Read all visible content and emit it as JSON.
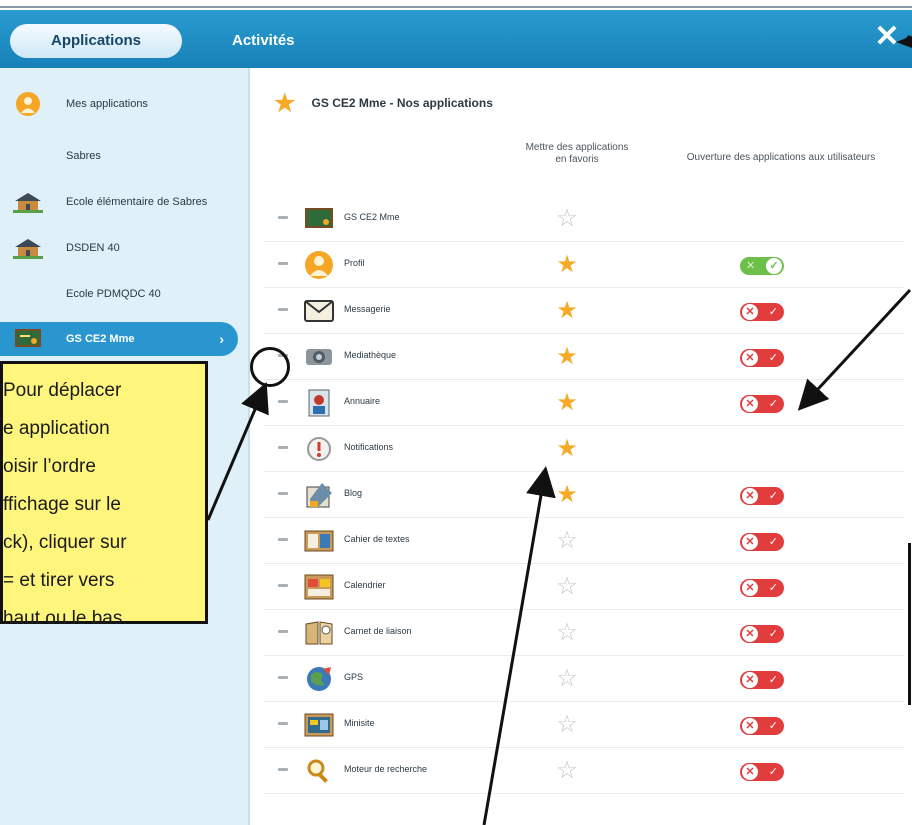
{
  "header": {
    "tab_applications": "Applications",
    "tab_activites": "Activités",
    "close_icon": "close-icon"
  },
  "sidebar": {
    "items": [
      {
        "label": "Mes applications",
        "icon": "user-apps-icon"
      },
      {
        "label": "Sabres",
        "icon": ""
      },
      {
        "label": "Ecole élémentaire de Sabres",
        "icon": "school-icon"
      },
      {
        "label": "DSDEN 40",
        "icon": "school-icon"
      },
      {
        "label": "Ecole PDMQDC 40",
        "icon": ""
      },
      {
        "label": "GS CE2 Mme",
        "icon": "class-icon",
        "active": true
      }
    ]
  },
  "main": {
    "title": "GS CE2 Mme - Nos applications",
    "col_favorites": "Mettre des applications en favoris",
    "col_open": "Ouverture des applications aux utilisateurs",
    "rows": [
      {
        "name": "GS CE2 Mme",
        "favorite": false,
        "toggle": null
      },
      {
        "name": "Profil",
        "favorite": true,
        "toggle": "on"
      },
      {
        "name": "Messagerie",
        "favorite": true,
        "toggle": "off"
      },
      {
        "name": "Mediathèque",
        "favorite": true,
        "toggle": "off"
      },
      {
        "name": "Annuaire",
        "favorite": true,
        "toggle": "off"
      },
      {
        "name": "Notifications",
        "favorite": true,
        "toggle": null
      },
      {
        "name": "Blog",
        "favorite": true,
        "toggle": "off"
      },
      {
        "name": "Cahier de textes",
        "favorite": false,
        "toggle": "off"
      },
      {
        "name": "Calendrier",
        "favorite": false,
        "toggle": "off"
      },
      {
        "name": "Carnet de liaison",
        "favorite": false,
        "toggle": "off"
      },
      {
        "name": "GPS",
        "favorite": false,
        "toggle": "off"
      },
      {
        "name": "Minisite",
        "favorite": false,
        "toggle": "off"
      },
      {
        "name": "Moteur de recherche",
        "favorite": false,
        "toggle": "off"
      }
    ]
  },
  "callout": {
    "lines": [
      "Pour déplacer",
      "e application",
      "oisir l’ordre",
      "ffichage sur le",
      "ck), cliquer sur",
      "= et tirer vers",
      "haut ou le bas."
    ]
  },
  "colors": {
    "header": "#1f8ec2",
    "sidebar": "#dff0f9",
    "star_on": "#f7a928",
    "toggle_off": "#e23d3d",
    "toggle_on": "#6cc04a",
    "callout": "#fdf57c"
  }
}
